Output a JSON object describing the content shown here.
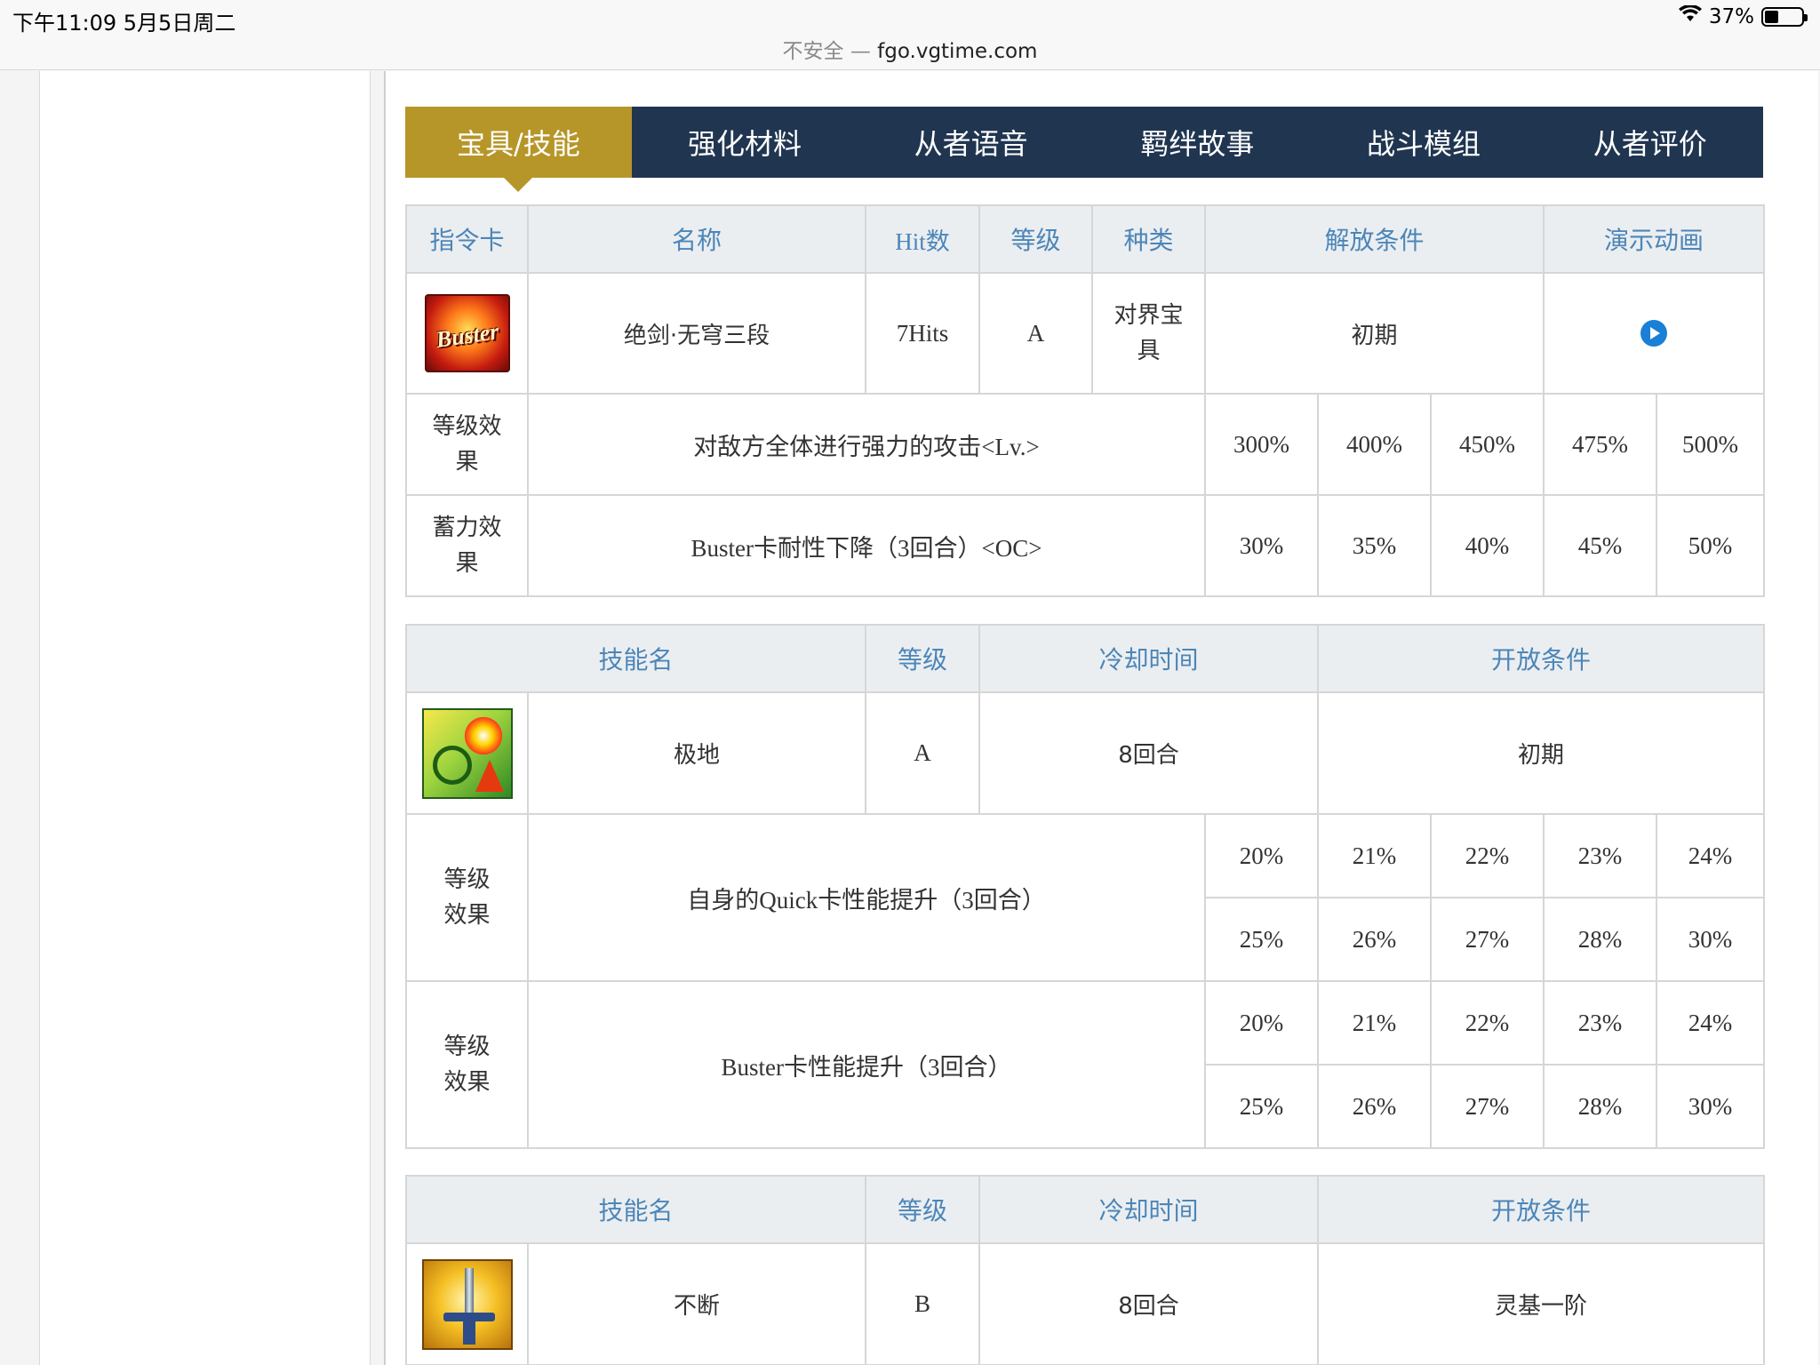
{
  "status": {
    "time": "下午11:09   5月5日周二",
    "battery": "37%",
    "battery_level": 0.37
  },
  "address": {
    "insecure": "不安全 —",
    "domain": "fgo.vgtime.com"
  },
  "tabs": [
    "宝具/技能",
    "强化材料",
    "从者语音",
    "羁绊故事",
    "战斗模组",
    "从者评价"
  ],
  "np": {
    "headers": [
      "指令卡",
      "名称",
      "Hit数",
      "等级",
      "种类",
      "解放条件",
      "演示动画"
    ],
    "card_icon_text": "Buster",
    "name": "绝剑·无穹三段",
    "hits": "7Hits",
    "rank": "A",
    "type": "对界宝具",
    "unlock": "初期",
    "level_label": "等级效果",
    "level_desc": "对敌方全体进行强力的攻击<Lv.>",
    "level_values": [
      "300%",
      "400%",
      "450%",
      "475%",
      "500%"
    ],
    "oc_label": "蓄力效果",
    "oc_desc": "Buster卡耐性下降（3回合）<OC>",
    "oc_values": [
      "30%",
      "35%",
      "40%",
      "45%",
      "50%"
    ]
  },
  "skill1": {
    "headers": [
      "技能名",
      "等级",
      "冷却时间",
      "开放条件"
    ],
    "name": "极地",
    "rank": "A",
    "cooldown": "8回合",
    "unlock": "初期",
    "effects": [
      {
        "label": "等级效果",
        "desc": "自身的Quick卡性能提升（3回合）",
        "row1": [
          "20%",
          "21%",
          "22%",
          "23%",
          "24%"
        ],
        "row2": [
          "25%",
          "26%",
          "27%",
          "28%",
          "30%"
        ]
      },
      {
        "label": "等级效果",
        "desc": "Buster卡性能提升（3回合）",
        "row1": [
          "20%",
          "21%",
          "22%",
          "23%",
          "24%"
        ],
        "row2": [
          "25%",
          "26%",
          "27%",
          "28%",
          "30%"
        ]
      }
    ]
  },
  "skill2": {
    "headers": [
      "技能名",
      "等级",
      "冷却时间",
      "开放条件"
    ],
    "name": "不断",
    "rank": "B",
    "cooldown": "8回合",
    "unlock": "灵基一阶"
  }
}
